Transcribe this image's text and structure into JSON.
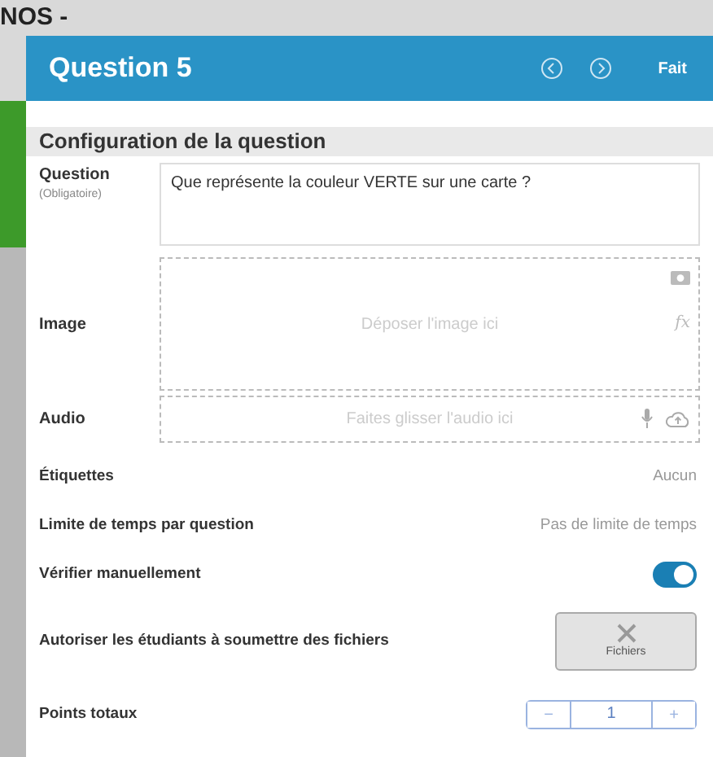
{
  "background": {
    "title": "NOS -"
  },
  "dialog": {
    "title": "Question 5",
    "done": "Fait"
  },
  "section": "Configuration de la question",
  "question": {
    "label": "Question",
    "hint": "(Obligatoire)",
    "value": "Que représente la couleur VERTE sur une carte ?"
  },
  "image": {
    "label": "Image",
    "placeholder": "Déposer l'image ici",
    "formula": "fx"
  },
  "audio": {
    "label": "Audio",
    "placeholder": "Faites glisser l'audio ici"
  },
  "settings": [
    {
      "kind": "value",
      "label": "Étiquettes",
      "value": "Aucun"
    },
    {
      "kind": "value",
      "label": "Limite de temps par question",
      "value": "Pas de limite de temps"
    },
    {
      "kind": "toggle",
      "label": "Vérifier manuellement",
      "on": true
    },
    {
      "kind": "files",
      "label": "Autoriser les étudiants à soumettre des fichiers",
      "button": "Fichiers",
      "enabled": false
    },
    {
      "kind": "stepper",
      "label": "Points totaux",
      "minus": "−",
      "value": "1",
      "plus": "+"
    }
  ]
}
